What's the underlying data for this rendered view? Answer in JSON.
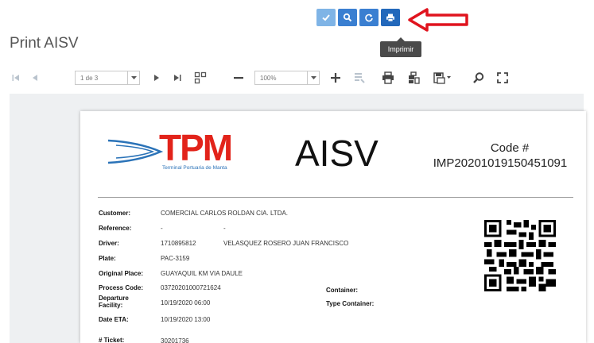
{
  "actions": {
    "buttons": [
      {
        "name": "check-button",
        "icon": "check-icon"
      },
      {
        "name": "search-button",
        "icon": "search-icon"
      },
      {
        "name": "refresh-button",
        "icon": "refresh-icon"
      },
      {
        "name": "print-button",
        "icon": "print-icon"
      }
    ],
    "tooltip": "Imprimir"
  },
  "page": {
    "title": "Print AISV"
  },
  "toolbar": {
    "page_select": "1 de 3",
    "zoom_select": "100%"
  },
  "report": {
    "logo_text": "TPM",
    "logo_subtitle": "Terminal Portuaria de Manta",
    "title": "AISV",
    "code_label": "Code #",
    "code_value": "IMP20201019150451091",
    "fields": {
      "customer_label": "Customer:",
      "customer_value": "COMERCIAL CARLOS ROLDAN CIA. LTDA.",
      "reference_label": "Reference:",
      "reference_value_1": "-",
      "reference_value_2": "-",
      "driver_label": "Driver:",
      "driver_id": "1710895812",
      "driver_name": "VELASQUEZ ROSERO JUAN FRANCISCO",
      "plate_label": "Plate:",
      "plate_value": "PAC-3159",
      "original_place_label": "Original Place:",
      "original_place_value": "GUAYAQUIL KM VIA DAULE",
      "process_code_label": "Process Code:",
      "process_code_value": "03720201000721624",
      "departure_label_1": "Departure",
      "departure_label_2": "Facility:",
      "departure_value": "10/19/2020 06:00",
      "eta_label": "Date ETA:",
      "eta_value": "10/19/2020 13:00",
      "ticket_label": "# Ticket:",
      "ticket_value": "30201736",
      "container_label": "Container:",
      "type_container_label": "Type Container:"
    }
  },
  "colors": {
    "accent": "#3a7fd1",
    "arrow": "#e0141e",
    "logo_red": "#e2231a",
    "logo_blue": "#2b73b8"
  }
}
